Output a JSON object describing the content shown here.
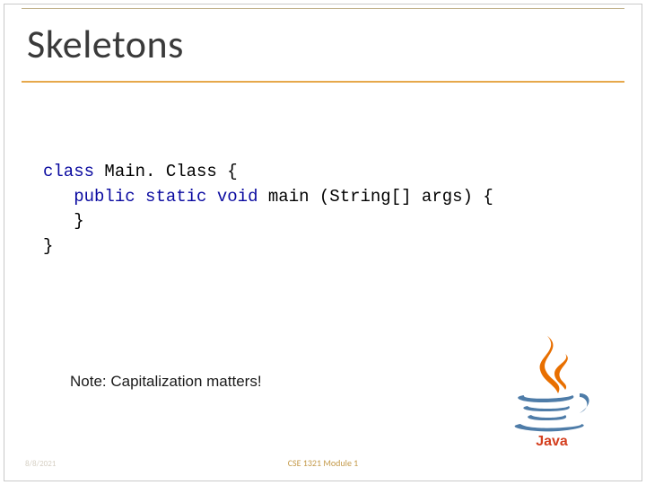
{
  "title": "Skeletons",
  "code": {
    "kw_class": "class",
    "class_name": " Main. Class {",
    "indent1": "   ",
    "kw_public": "public",
    "sp1": " ",
    "kw_static": "static",
    "sp2": " ",
    "kw_void": "void",
    "main_sig": " main (String[] args) {",
    "close_inner": "   }",
    "close_outer": "}"
  },
  "note": "Note: Capitalization matters!",
  "footer": {
    "center": "CSE 1321 Module 1",
    "left": "8/8/2021"
  },
  "logo": {
    "wordmark": "Java"
  }
}
